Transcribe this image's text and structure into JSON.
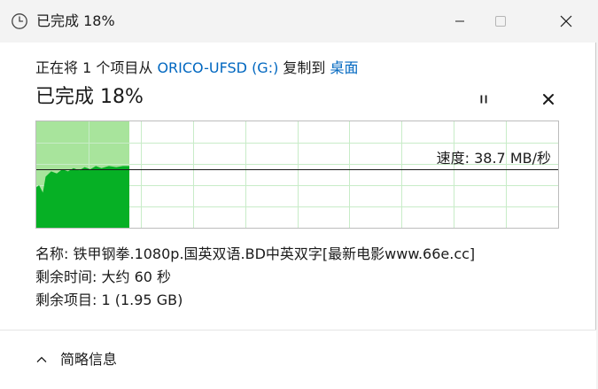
{
  "window": {
    "title": "已完成 18%",
    "minimize_icon": "minimize-icon",
    "maximize_icon": "maximize-icon",
    "close_icon": "close-icon"
  },
  "header": {
    "prefix": "正在将 1 个项目从 ",
    "source": "ORICO-UFSD (G:)",
    "middle": " 复制到 ",
    "destination": "桌面",
    "status": "已完成 18%",
    "progress_percent": 18,
    "pause_icon": "pause-icon",
    "cancel_icon": "close-icon"
  },
  "graph": {
    "speed_text": "速度: 38.7 MB/秒",
    "current_speed": 38.7,
    "fill_color": "#06b025",
    "background_fill_color": "#a8e49c",
    "grid_color": "#c8ecc8",
    "line_color": "#1b1b1b"
  },
  "details": {
    "name": "名称: 铁甲钢拳.1080p.国英双语.BD中英双字[最新电影www.66e.cc]",
    "time_remaining": "剩余时间: 大约 60 秒",
    "items_remaining": "剩余项目: 1 (1.95 GB)"
  },
  "footer": {
    "toggle_label": "简略信息",
    "toggle_icon": "chevron-up-icon"
  }
}
